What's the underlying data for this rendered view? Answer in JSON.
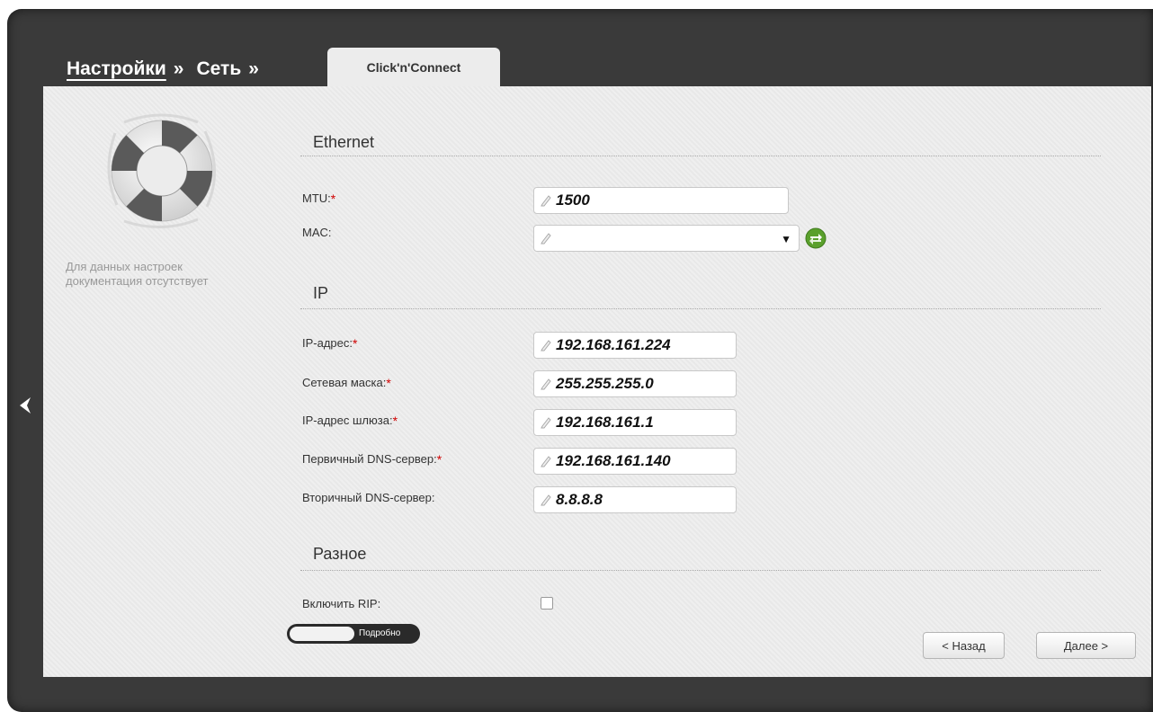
{
  "breadcrumb": {
    "items": [
      {
        "label": "Настройки"
      },
      {
        "label": "Сеть"
      }
    ],
    "separator": "»",
    "active_tab": "Click'n'Connect"
  },
  "sidebar": {
    "no_doc_text": "Для данных настроек документация отсутствует"
  },
  "sections": {
    "ethernet": {
      "title": "Ethernet",
      "mtu": {
        "label": "MTU:",
        "value": "1500"
      },
      "mac": {
        "label": "MAC:",
        "value": ""
      }
    },
    "ip": {
      "title": "IP",
      "ip_address": {
        "label": "IP-адрес:",
        "value": "192.168.161.224"
      },
      "netmask": {
        "label": "Сетевая маска:",
        "value": "255.255.255.0"
      },
      "gateway": {
        "label": "IP-адрес шлюза:",
        "value": "192.168.161.1"
      },
      "dns1": {
        "label": "Первичный DNS-сервер:",
        "value": "192.168.161.140"
      },
      "dns2": {
        "label": "Вторичный DNS-сервер:",
        "value": "8.8.8.8"
      }
    },
    "misc": {
      "title": "Разное",
      "rip": {
        "label": "Включить RIP:",
        "checked": false
      }
    }
  },
  "required_mark": "*",
  "toggle": {
    "label": "Подробно"
  },
  "buttons": {
    "back": "< Назад",
    "next": "Далее >"
  },
  "colors": {
    "frame": "#3a3a3a",
    "panel": "#ececec",
    "required": "#d00000",
    "refresh_icon": "#5aa02c"
  }
}
